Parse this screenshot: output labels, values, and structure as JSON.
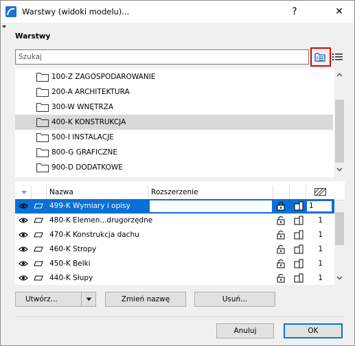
{
  "window": {
    "title": "Warstwy (widoki modelu)...",
    "help_label": "?",
    "close_label": "✕"
  },
  "section_heading": "Warstwy",
  "search": {
    "placeholder": "Szukaj"
  },
  "folders": [
    {
      "label": "100-Z ZAGOSPODAROWANIE",
      "selected": false
    },
    {
      "label": "200-A ARCHITEKTURA",
      "selected": false
    },
    {
      "label": "300-W WNĘTRZA",
      "selected": false
    },
    {
      "label": "400-K KONSTRUKCJA",
      "selected": true
    },
    {
      "label": "500-I INSTALACJE",
      "selected": false
    },
    {
      "label": "800-G GRAFICZNE",
      "selected": false
    },
    {
      "label": "900-D DODATKOWE",
      "selected": false
    }
  ],
  "layer_table": {
    "columns": {
      "name": "Nazwa",
      "extension": "Rozszerzenie"
    },
    "rows": [
      {
        "name": "499-K Wymiary i opisy",
        "value": "1",
        "selected": true
      },
      {
        "name": "480-K Elemen...drugorzędne",
        "value": "1",
        "selected": false
      },
      {
        "name": "470-K Konstrukcja dachu",
        "value": "1",
        "selected": false
      },
      {
        "name": "460-K Stropy",
        "value": "1",
        "selected": false
      },
      {
        "name": "450-K Belki",
        "value": "1",
        "selected": false
      },
      {
        "name": "440-K Słupy",
        "value": "1",
        "selected": false
      }
    ]
  },
  "buttons": {
    "create": "Utwórz...",
    "rename": "Zmień nazwę",
    "delete": "Usuń...",
    "cancel": "Anuluj",
    "ok": "OK"
  },
  "colors": {
    "selection": "#0a6fd6",
    "highlight_border": "#e00000",
    "folder_selected": "#d9d9d9"
  }
}
